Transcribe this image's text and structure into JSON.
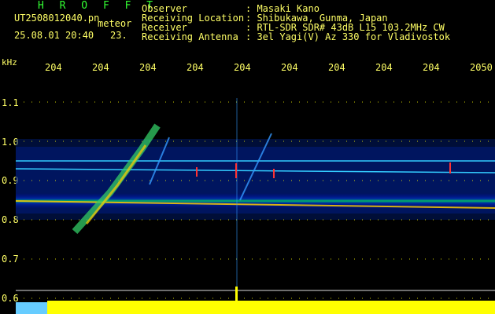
{
  "header": {
    "title": "H R O F F T",
    "filename": "UT2508012040.pn",
    "meteor_label": "meteor",
    "datetime": "25.08.01 20:40",
    "extra": "23."
  },
  "info": [
    {
      "label": "Observer",
      "value": ": Masaki Kano"
    },
    {
      "label": "Receiving Location",
      "value": ": Shibukawa, Gunma, Japan"
    },
    {
      "label": "Receiver",
      "value": ": RTL-SDR SDR# 43dB L15 103.2MHz CW"
    },
    {
      "label": "Receiving Antenna",
      "value": ": 3el Yagi(V) Az 330 for Vladivostok"
    }
  ],
  "axes": {
    "y_unit": "kHz",
    "y_ticks": [
      "1.1",
      "1.0",
      "0.9",
      "0.8",
      "0.7",
      "0.6"
    ],
    "x_ticks": [
      "204",
      "204",
      "204",
      "204",
      "204",
      "204",
      "204",
      "204",
      "204",
      "2050"
    ]
  },
  "colors": {
    "background": "#000000",
    "text": "#ffff66",
    "title": "#33ff33",
    "grid": "#ffff00",
    "bars": "#ffff00",
    "bars_left": "#66ccff"
  }
}
